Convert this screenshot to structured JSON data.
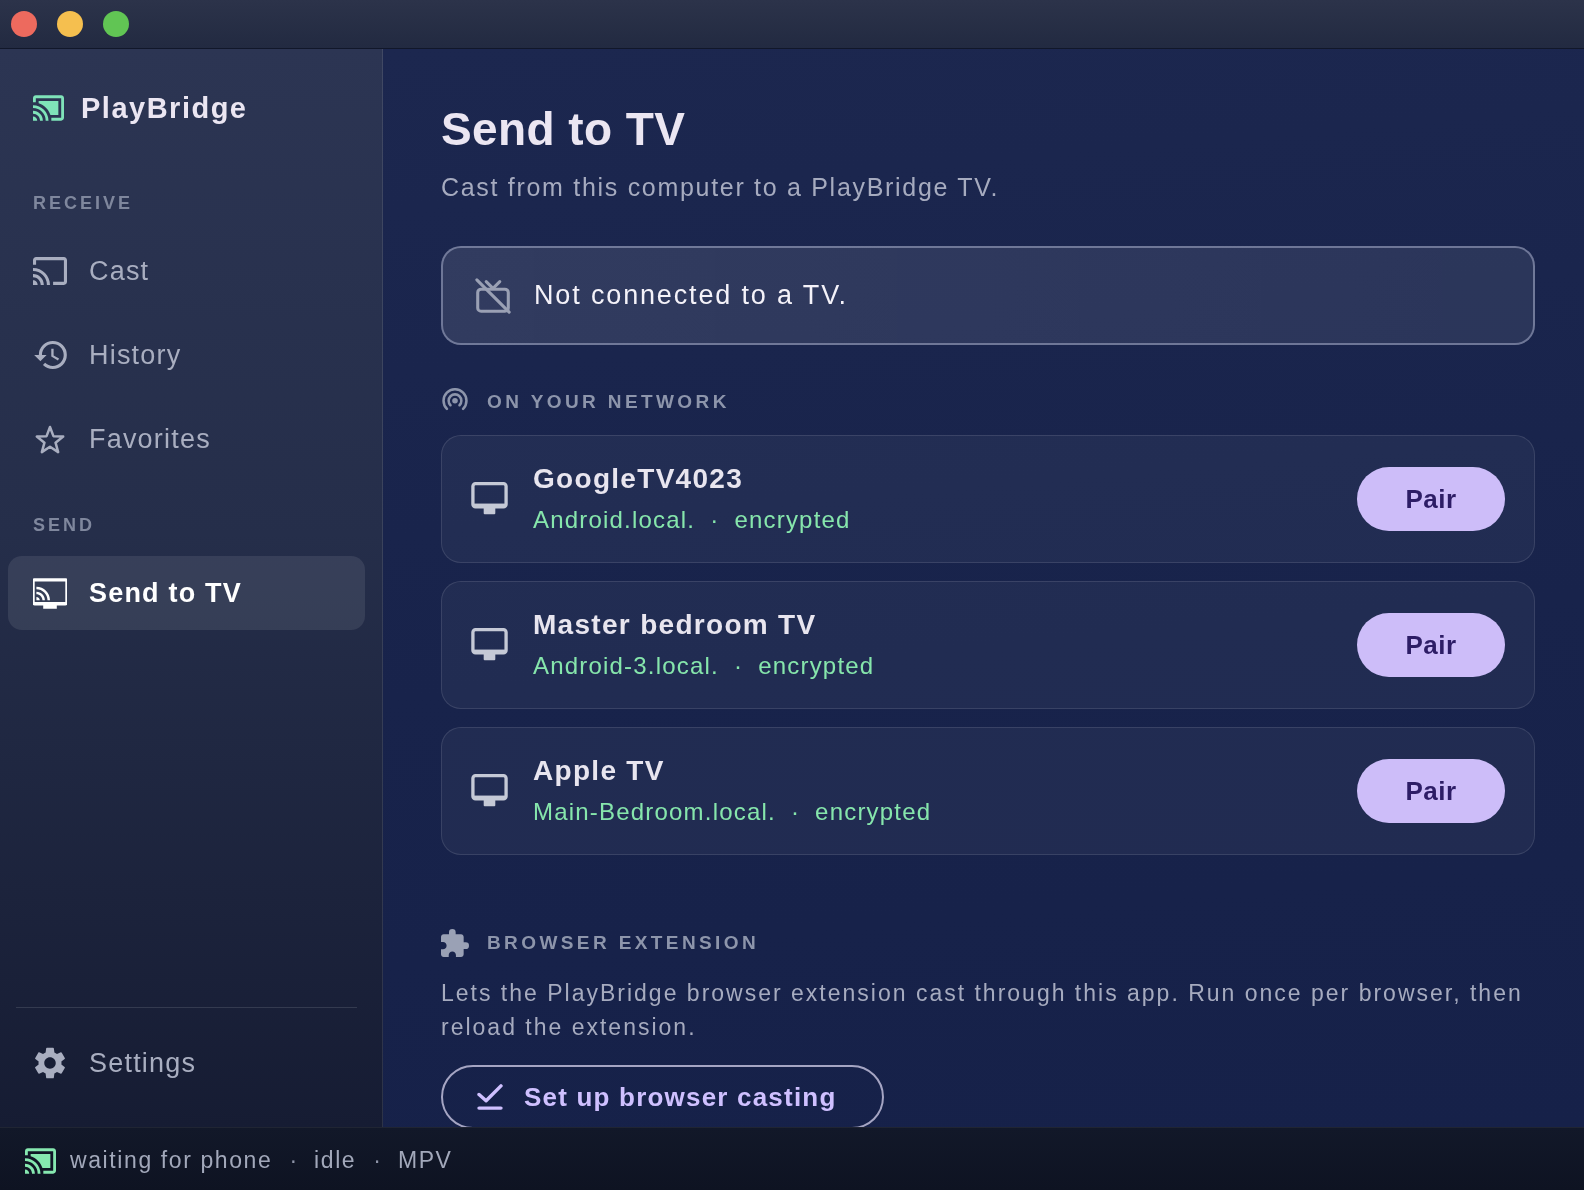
{
  "sidebar": {
    "brand": "PlayBridge",
    "sections": [
      {
        "title": "RECEIVE",
        "items": [
          {
            "label": "Cast",
            "selected": false
          },
          {
            "label": "History",
            "selected": false
          },
          {
            "label": "Favorites",
            "selected": false
          }
        ]
      },
      {
        "title": "SEND",
        "items": [
          {
            "label": "Send to TV",
            "selected": true
          }
        ]
      }
    ],
    "footer_items": [
      {
        "label": "Settings",
        "selected": false
      }
    ]
  },
  "main": {
    "title": "Send to TV",
    "subtitle": "Cast from this computer to a PlayBridge TV.",
    "connection": {
      "connected": false,
      "message": "Not connected to a TV."
    },
    "network": {
      "heading": "ON YOUR NETWORK",
      "devices": [
        {
          "name": "GoogleTV4023",
          "host": "Android.local.",
          "separator": "·",
          "security": "encrypted",
          "action": "Pair"
        },
        {
          "name": "Master bedroom TV",
          "host": "Android-3.local.",
          "separator": "·",
          "security": "encrypted",
          "action": "Pair"
        },
        {
          "name": "Apple TV",
          "host": "Main-Bedroom.local.",
          "separator": "·",
          "security": "encrypted",
          "action": "Pair"
        }
      ]
    },
    "extension": {
      "heading": "BROWSER EXTENSION",
      "description": "Lets the PlayBridge browser extension cast through this app. Run once per browser, then reload the extension.",
      "action": "Set up browser casting"
    }
  },
  "status_bar": {
    "items": [
      {
        "kind": "text",
        "text": "waiting for phone"
      },
      {
        "kind": "separator",
        "text": "·"
      },
      {
        "kind": "text",
        "text": "idle"
      },
      {
        "kind": "separator",
        "text": "·"
      },
      {
        "kind": "text",
        "text": "MPV"
      }
    ]
  }
}
